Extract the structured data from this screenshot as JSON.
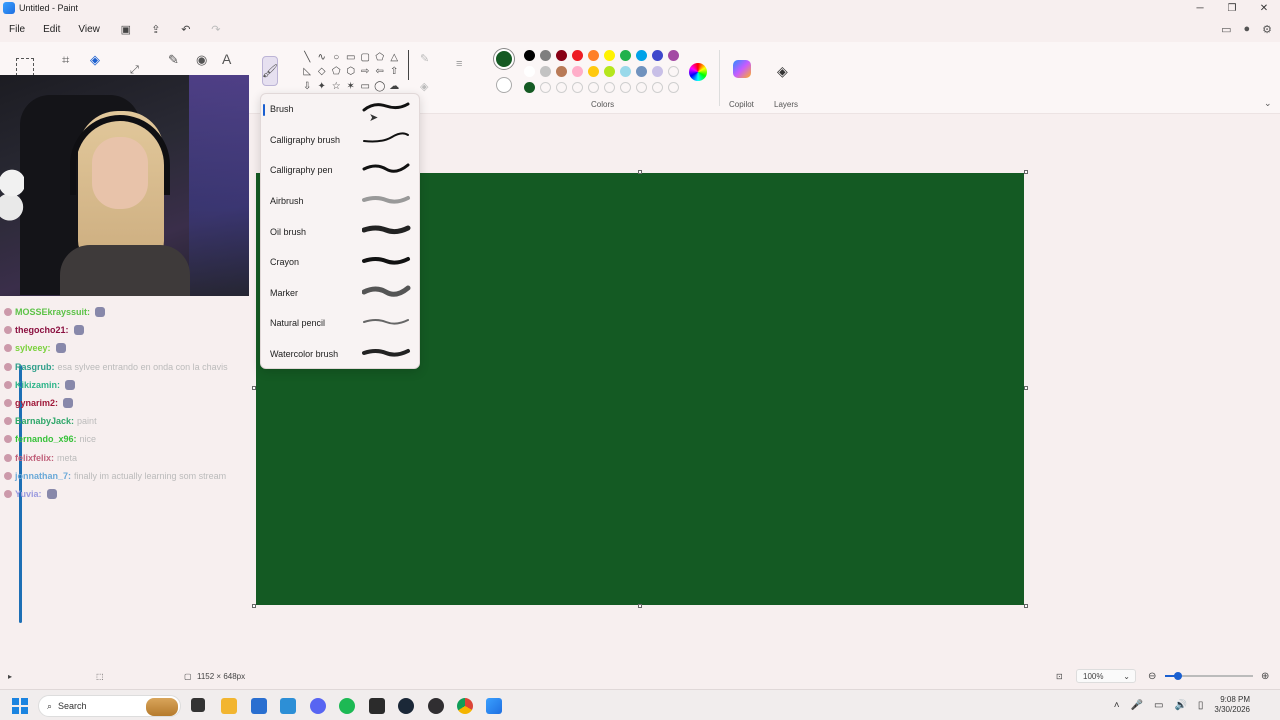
{
  "window": {
    "title": "Untitled - Paint"
  },
  "menu": {
    "file": "File",
    "edit": "Edit",
    "view": "View"
  },
  "ribbon": {
    "colors_label": "Colors",
    "copilot_label": "Copilot",
    "layers_label": "Layers",
    "active_color": "#145a23",
    "palette": [
      "#000000",
      "#7f7f7f",
      "#880015",
      "#ed1c24",
      "#ff7f27",
      "#fff200",
      "#22b14c",
      "#00a2e8",
      "#3f48cc",
      "#a349a4",
      "#ffffff",
      "#c3c3c3",
      "#b97a57",
      "#ffaec9",
      "#ffc90e",
      "#b5e61d",
      "#99d9ea",
      "#7092be",
      "#c8bfe7",
      "",
      "#145a23",
      "",
      "",
      "",
      "",
      "",
      "",
      "",
      "",
      ""
    ]
  },
  "brush_menu": {
    "items": [
      {
        "label": "Brush",
        "selected": true
      },
      {
        "label": "Calligraphy brush"
      },
      {
        "label": "Calligraphy pen"
      },
      {
        "label": "Airbrush"
      },
      {
        "label": "Oil brush"
      },
      {
        "label": "Crayon"
      },
      {
        "label": "Marker"
      },
      {
        "label": "Natural pencil"
      },
      {
        "label": "Watercolor brush"
      }
    ]
  },
  "chat": [
    {
      "user": "MOSSEkrayssuit:",
      "color": "#5cc247",
      "msg": ""
    },
    {
      "user": "thegocho21:",
      "color": "#8b1040",
      "msg": ""
    },
    {
      "user": "sylveey:",
      "color": "#7bd23c",
      "msg": ""
    },
    {
      "user": "Rasgrub:",
      "color": "#2f9f8a",
      "msg": "esa sylvee entrando en onda con la chavis"
    },
    {
      "user": "Kikizamin:",
      "color": "#2fb58a",
      "msg": ""
    },
    {
      "user": "gynarim2:",
      "color": "#a01a3a",
      "msg": ""
    },
    {
      "user": "BarnabyJack:",
      "color": "#2fa76a",
      "msg": "paint"
    },
    {
      "user": "fernando_x96:",
      "color": "#38c23a",
      "msg": "nice"
    },
    {
      "user": "felixfelix:",
      "color": "#c0607a",
      "msg": "meta"
    },
    {
      "user": "jonnathan_7:",
      "color": "#6aa9d8",
      "msg": "finally im actually learning som stream"
    },
    {
      "user": "Yuvia:",
      "color": "#9a9adf",
      "msg": ""
    }
  ],
  "status": {
    "canvas_size": "1152 × 648px",
    "zoom": "100%",
    "zoom_fraction": 0.15
  },
  "taskbar": {
    "search": "Search",
    "time": "9:08 PM",
    "date": "3/30/2026"
  }
}
